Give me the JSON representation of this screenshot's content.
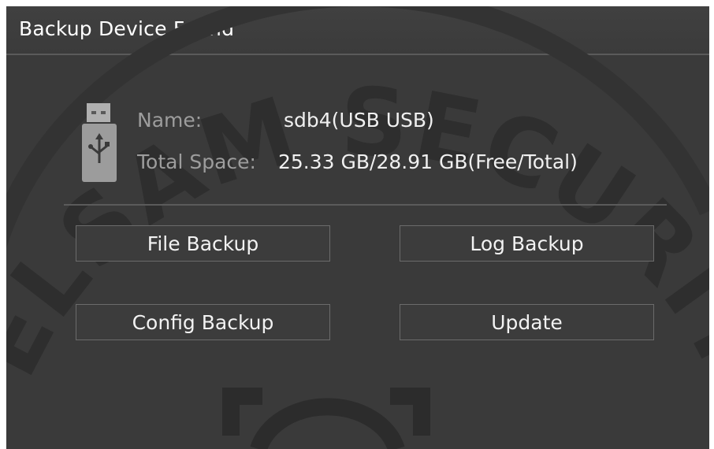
{
  "dialog": {
    "title": "Backup Device Found"
  },
  "device": {
    "icon": "usb-drive-icon",
    "name_label": "Name:",
    "name_value": "sdb4(USB USB)",
    "space_label": "Total Space:",
    "space_value": "25.33 GB/28.91 GB(Free/Total)"
  },
  "buttons": {
    "file_backup": "File Backup",
    "log_backup": "Log Backup",
    "config_backup": "Config Backup",
    "update": "Update"
  },
  "watermark": {
    "text": "ELSAM SECURITY"
  },
  "colors": {
    "background": "#3a3a3a",
    "text": "#f0f0f0",
    "label": "#9d9d9d",
    "border": "#6b6b6b"
  }
}
